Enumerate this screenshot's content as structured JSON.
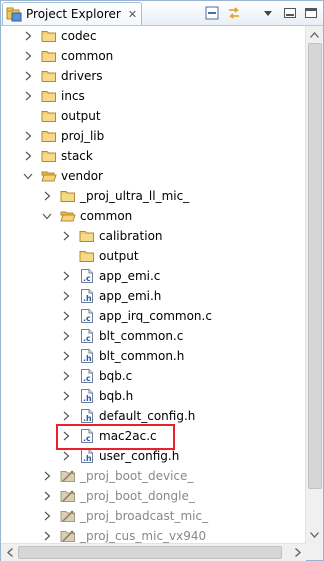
{
  "window": {
    "title": "Project Explorer",
    "tab_icon": "project-explorer-icon",
    "close_glyph": "✕",
    "toolbar": [
      {
        "name": "collapse-all-icon"
      },
      {
        "name": "link-with-editor-icon"
      },
      {
        "name": "view-menu-icon"
      },
      {
        "name": "minimize-icon"
      },
      {
        "name": "maximize-icon"
      }
    ]
  },
  "tree": {
    "items": [
      {
        "label": "codec",
        "kind": "folder",
        "state": "collapsed",
        "depth": 0
      },
      {
        "label": "common",
        "kind": "folder",
        "state": "collapsed",
        "depth": 0
      },
      {
        "label": "drivers",
        "kind": "folder",
        "state": "collapsed",
        "depth": 0
      },
      {
        "label": "incs",
        "kind": "folder",
        "state": "collapsed",
        "depth": 0
      },
      {
        "label": "output",
        "kind": "folder",
        "state": "none",
        "depth": 0
      },
      {
        "label": "proj_lib",
        "kind": "folder",
        "state": "collapsed",
        "depth": 0
      },
      {
        "label": "stack",
        "kind": "folder",
        "state": "collapsed",
        "depth": 0
      },
      {
        "label": "vendor",
        "kind": "folder-open",
        "state": "expanded",
        "depth": 0
      },
      {
        "label": "_proj_ultra_ll_mic_",
        "kind": "folder",
        "state": "collapsed",
        "depth": 1
      },
      {
        "label": "common",
        "kind": "folder-open",
        "state": "expanded",
        "depth": 1
      },
      {
        "label": "calibration",
        "kind": "folder",
        "state": "collapsed",
        "depth": 2
      },
      {
        "label": "output",
        "kind": "folder",
        "state": "none",
        "depth": 2
      },
      {
        "label": "app_emi.c",
        "kind": "c-file",
        "state": "collapsed",
        "depth": 2
      },
      {
        "label": "app_emi.h",
        "kind": "h-file",
        "state": "collapsed",
        "depth": 2
      },
      {
        "label": "app_irq_common.c",
        "kind": "c-file",
        "state": "collapsed",
        "depth": 2
      },
      {
        "label": "blt_common.c",
        "kind": "c-file",
        "state": "collapsed",
        "depth": 2
      },
      {
        "label": "blt_common.h",
        "kind": "h-file",
        "state": "collapsed",
        "depth": 2
      },
      {
        "label": "bqb.c",
        "kind": "c-file",
        "state": "collapsed",
        "depth": 2
      },
      {
        "label": "bqb.h",
        "kind": "h-file",
        "state": "collapsed",
        "depth": 2
      },
      {
        "label": "default_config.h",
        "kind": "h-file",
        "state": "collapsed",
        "depth": 2
      },
      {
        "label": "mac2ac.c",
        "kind": "c-file",
        "state": "collapsed",
        "depth": 2,
        "highlighted": true
      },
      {
        "label": "user_config.h",
        "kind": "h-file",
        "state": "collapsed",
        "depth": 2
      },
      {
        "label": "_proj_boot_device_",
        "kind": "excluded-folder",
        "state": "collapsed",
        "depth": 1
      },
      {
        "label": "_proj_boot_dongle_",
        "kind": "excluded-folder",
        "state": "collapsed",
        "depth": 1
      },
      {
        "label": "_proj_broadcast_mic_",
        "kind": "excluded-folder",
        "state": "collapsed",
        "depth": 1
      },
      {
        "label": "_proj_cus_mic_vx940",
        "kind": "excluded-folder",
        "state": "collapsed",
        "depth": 1
      }
    ]
  },
  "colors": {
    "highlight_border": "#e8212b",
    "folder": "#e8b94a",
    "excluded_text": "#888888",
    "panel_border": "#99b4d1"
  }
}
